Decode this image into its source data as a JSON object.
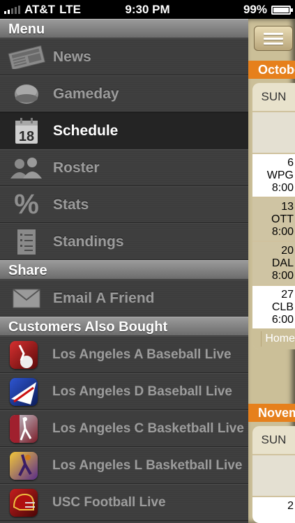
{
  "status_bar": {
    "carrier": "AT&T",
    "network": "LTE",
    "time": "9:30 PM",
    "battery": "99%",
    "battery_level": 0.99,
    "signal_bars": 2
  },
  "menu": {
    "header": "Menu",
    "items": [
      {
        "label": "News",
        "icon": "newspaper-icon",
        "active": false
      },
      {
        "label": "Gameday",
        "icon": "ball-icon",
        "active": false
      },
      {
        "label": "Schedule",
        "icon": "calendar-icon",
        "calendar_number": "18",
        "active": true
      },
      {
        "label": "Roster",
        "icon": "people-icon",
        "active": false
      },
      {
        "label": "Stats",
        "icon": "percent-icon",
        "active": false
      },
      {
        "label": "Standings",
        "icon": "list-icon",
        "active": false
      }
    ]
  },
  "share": {
    "header": "Share",
    "items": [
      {
        "label": "Email A Friend",
        "icon": "envelope-icon"
      }
    ]
  },
  "also_bought": {
    "header": "Customers Also Bought",
    "items": [
      {
        "label": "Los Angeles A Baseball Live",
        "color": "#b01e1e"
      },
      {
        "label": "Los Angeles D Baseball Live",
        "color": "#1e3fa8"
      },
      {
        "label": "Los Angeles C Basketball Live",
        "color": "#8a1e2a"
      },
      {
        "label": "Los Angeles L Basketball Live",
        "color": "#d9a21a"
      },
      {
        "label": "USC Football Live",
        "color": "#9c1414"
      }
    ]
  },
  "calendar": {
    "month1": "October",
    "month2": "November",
    "day_header": "SUN",
    "games": [
      {
        "date": "6",
        "opponent": "WPG",
        "time": "8:00"
      },
      {
        "date": "13",
        "opponent": "OTT",
        "time": "8:00"
      },
      {
        "date": "20",
        "opponent": "DAL",
        "time": "8:00"
      },
      {
        "date": "27",
        "opponent": "CLB",
        "time": "6:00"
      }
    ],
    "legend_label": "Home",
    "next_first_cell": "2"
  }
}
